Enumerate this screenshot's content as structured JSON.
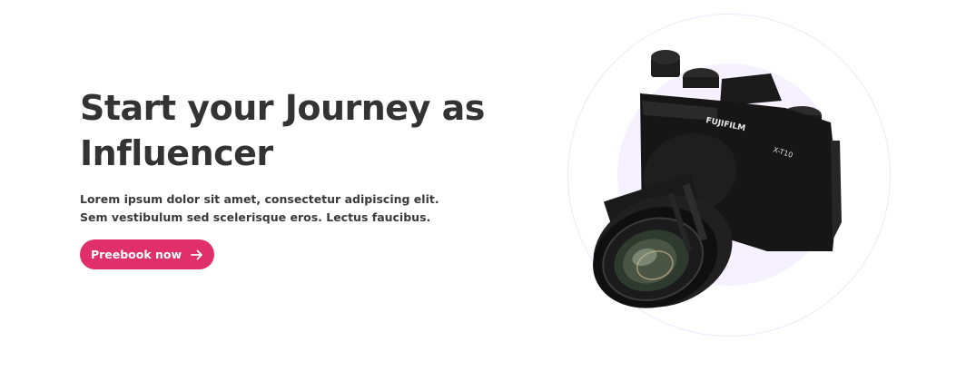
{
  "hero": {
    "headline_line1": "Start your Journey as",
    "headline_line2": "Influencer",
    "subtext": "Lorem ipsum dolor sit amet, consectetur adipiscing elit. Sem vestibulum sed scelerisque eros. Lectus faucibus.",
    "cta_label": "Preebook now",
    "cta_icon": "arrow-right-icon"
  },
  "camera": {
    "brand": "FUJIFILM",
    "model": "X-T10",
    "image_name": "camera-image"
  },
  "colors": {
    "accent": "#e02f6b",
    "heading": "#333333",
    "circle_fill": "#f5f1fe",
    "circle_ring": "#ede8fb"
  }
}
